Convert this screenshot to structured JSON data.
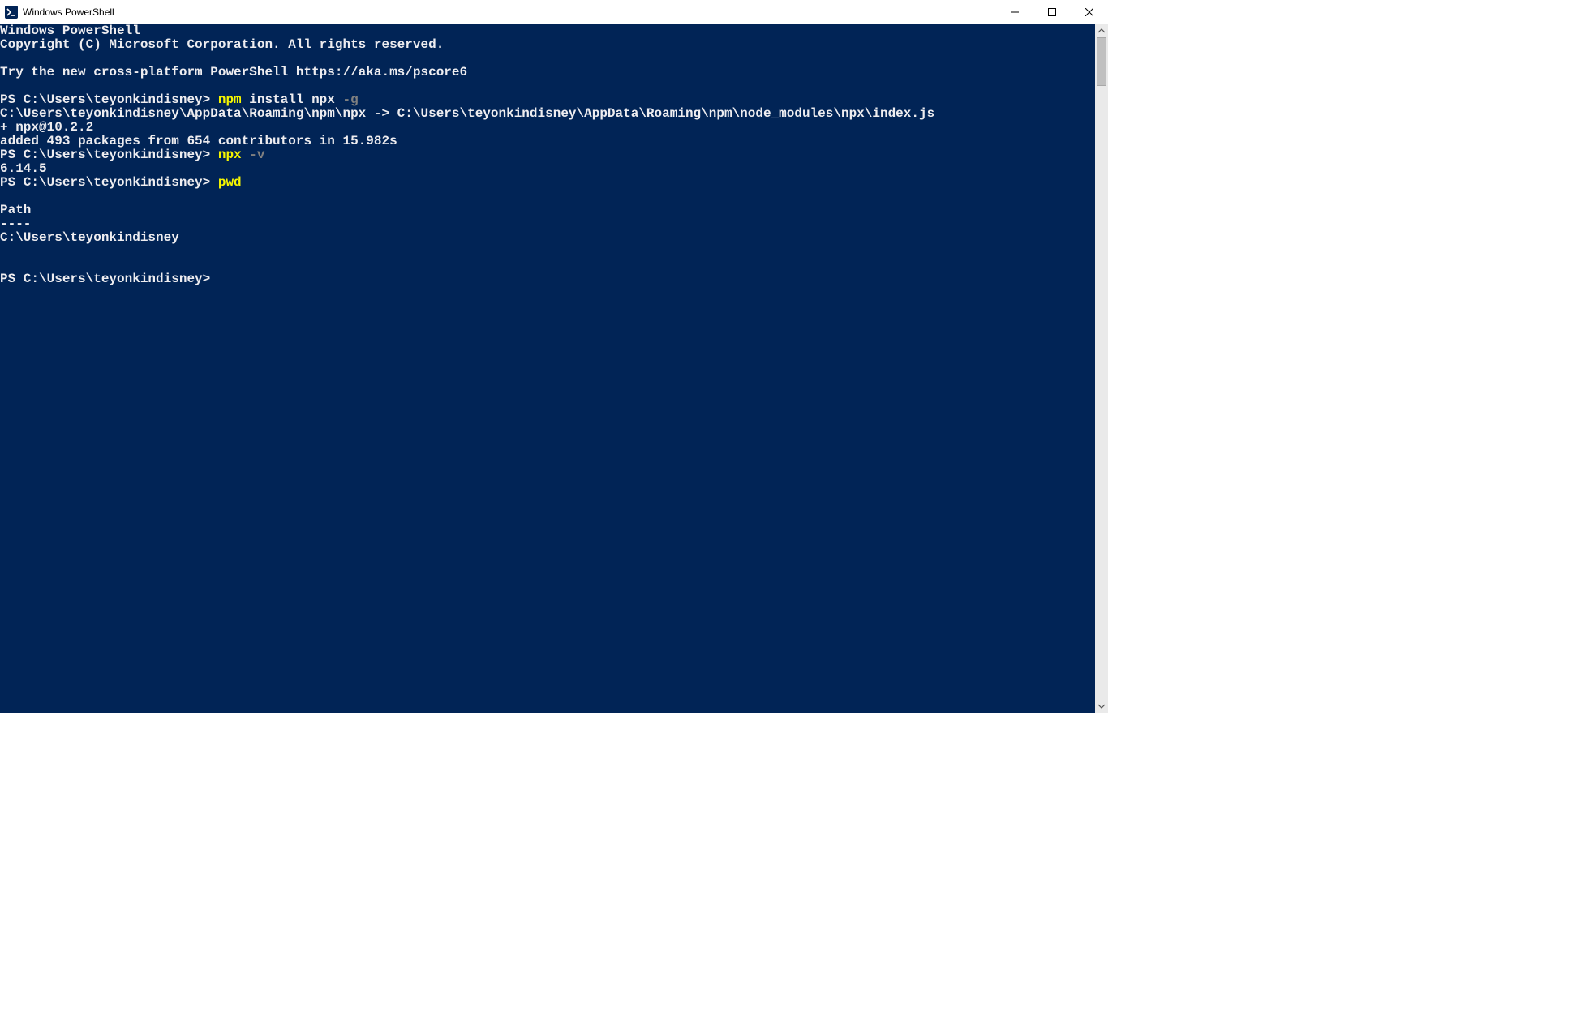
{
  "window": {
    "title": "Windows PowerShell"
  },
  "terminal": {
    "banner1": "Windows PowerShell",
    "banner2": "Copyright (C) Microsoft Corporation. All rights reserved.",
    "blank": "",
    "tryline": "Try the new cross-platform PowerShell https://aka.ms/pscore6",
    "prompt": "PS C:\\Users\\teyonkindisney> ",
    "cmd1_kw": "npm",
    "cmd1_args": " install npx ",
    "cmd1_flag": "-g",
    "out1a": "C:\\Users\\teyonkindisney\\AppData\\Roaming\\npm\\npx -> C:\\Users\\teyonkindisney\\AppData\\Roaming\\npm\\node_modules\\npx\\index.js",
    "out1b": "+ npx@10.2.2",
    "out1c": "added 493 packages from 654 contributors in 15.982s",
    "cmd2_kw": "npx",
    "cmd2_sp": " ",
    "cmd2_flag": "-v",
    "out2": "6.14.5",
    "cmd3_kw": "pwd",
    "out3a": "Path",
    "out3b": "----",
    "out3c": "C:\\Users\\teyonkindisney"
  }
}
